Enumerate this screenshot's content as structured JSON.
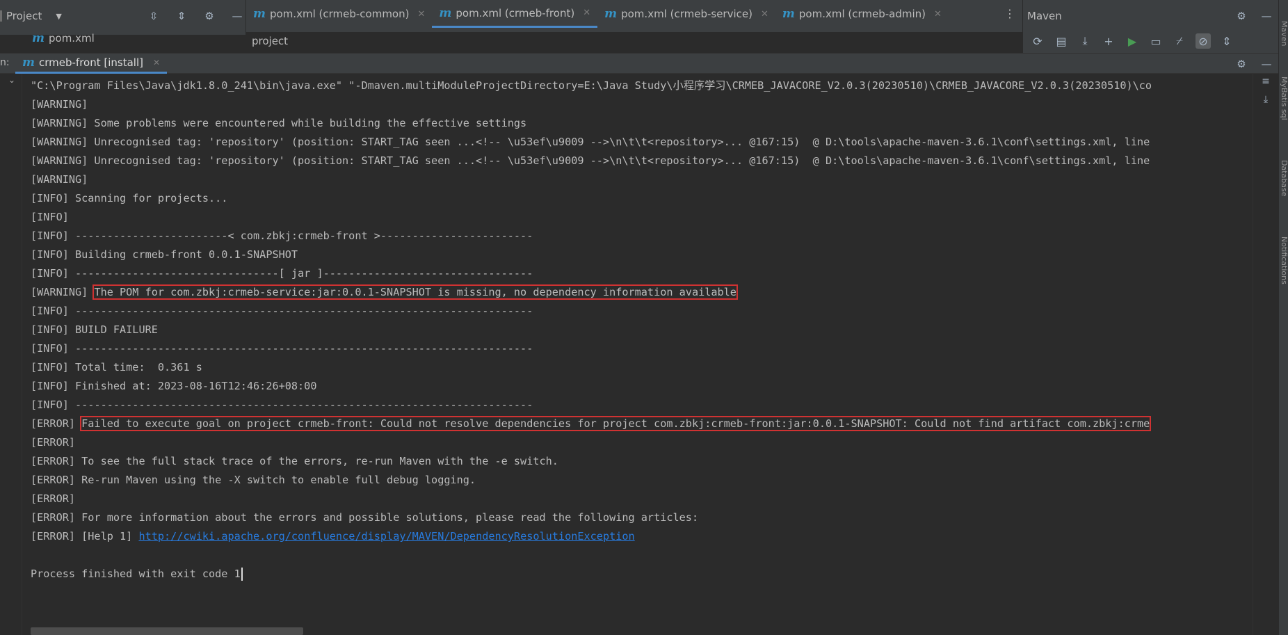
{
  "project_panel": {
    "title": "Project",
    "dropdown_glyph": "▼",
    "tool_icons": [
      "expand-all-icon",
      "collapse-all-icon",
      "gear-icon",
      "minimize-icon"
    ],
    "file": "pom.xml"
  },
  "editor": {
    "tabs": [
      {
        "label": "pom.xml (crmeb-common)",
        "active": false
      },
      {
        "label": "pom.xml (crmeb-front)",
        "active": true
      },
      {
        "label": "pom.xml (crmeb-service)",
        "active": false
      },
      {
        "label": "pom.xml (crmeb-admin)",
        "active": false
      }
    ],
    "breadcrumb": "project"
  },
  "maven": {
    "title": "Maven",
    "toolbar_icons": [
      "reload-icon",
      "add-project-icon",
      "download-icon",
      "plus-icon",
      "run-icon",
      "execute-goal-icon",
      "toggle-offline-icon",
      "skip-tests-icon",
      "collapse-icon"
    ]
  },
  "right_strip": {
    "labels": [
      "Maven",
      "MyBatis sql",
      "Database",
      "Notifications"
    ]
  },
  "run": {
    "prefix": "n:",
    "tab_label": "crmeb-front [install]"
  },
  "console": {
    "lines": [
      "\"C:\\Program Files\\Java\\jdk1.8.0_241\\bin\\java.exe\" \"-Dmaven.multiModuleProjectDirectory=E:\\Java Study\\小程序学习\\CRMEB_JAVACORE_V2.0.3(20230510)\\CRMEB_JAVACORE_V2.0.3(20230510)\\co",
      "[WARNING]",
      "[WARNING] Some problems were encountered while building the effective settings",
      "[WARNING] Unrecognised tag: 'repository' (position: START_TAG seen ...<!-- \\u53ef\\u9009 -->\\n\\t\\t<repository>... @167:15)  @ D:\\tools\\apache-maven-3.6.1\\conf\\settings.xml, line",
      "[WARNING] Unrecognised tag: 'repository' (position: START_TAG seen ...<!-- \\u53ef\\u9009 -->\\n\\t\\t<repository>... @167:15)  @ D:\\tools\\apache-maven-3.6.1\\conf\\settings.xml, line",
      "[WARNING]",
      "[INFO] Scanning for projects...",
      "[INFO]",
      "[INFO] ------------------------< com.zbkj:crmeb-front >------------------------",
      "[INFO] Building crmeb-front 0.0.1-SNAPSHOT",
      "[INFO] --------------------------------[ jar ]---------------------------------"
    ],
    "warning_pom": {
      "prefix": "[WARNING] ",
      "text": "The POM for com.zbkj:crmeb-service:jar:0.0.1-SNAPSHOT is missing, no dependency information available"
    },
    "lines2": [
      "[INFO] ------------------------------------------------------------------------",
      "[INFO] BUILD FAILURE",
      "[INFO] ------------------------------------------------------------------------",
      "[INFO] Total time:  0.361 s",
      "[INFO] Finished at: 2023-08-16T12:46:26+08:00",
      "[INFO] ------------------------------------------------------------------------"
    ],
    "error_goal": {
      "prefix": "[ERROR] ",
      "text": "Failed to execute goal on project crmeb-front: Could not resolve dependencies for project com.zbkj:crmeb-front:jar:0.0.1-SNAPSHOT: Could not find artifact com.zbkj:crme"
    },
    "lines3": [
      "[ERROR]",
      "[ERROR] To see the full stack trace of the errors, re-run Maven with the -e switch.",
      "[ERROR] Re-run Maven using the -X switch to enable full debug logging.",
      "[ERROR]",
      "[ERROR] For more information about the errors and possible solutions, please read the following articles:"
    ],
    "help": {
      "prefix": "[ERROR] [Help 1] ",
      "url": "http://cwiki.apache.org/confluence/display/MAVEN/DependencyResolutionException"
    },
    "exit_line": "Process finished with exit code 1"
  },
  "colors": {
    "background": "#2b2b2b",
    "panel": "#3c3f41",
    "text": "#bbbbbb",
    "link": "#287bde",
    "highlight_box": "#d03232",
    "accent": "#4a88c7"
  }
}
